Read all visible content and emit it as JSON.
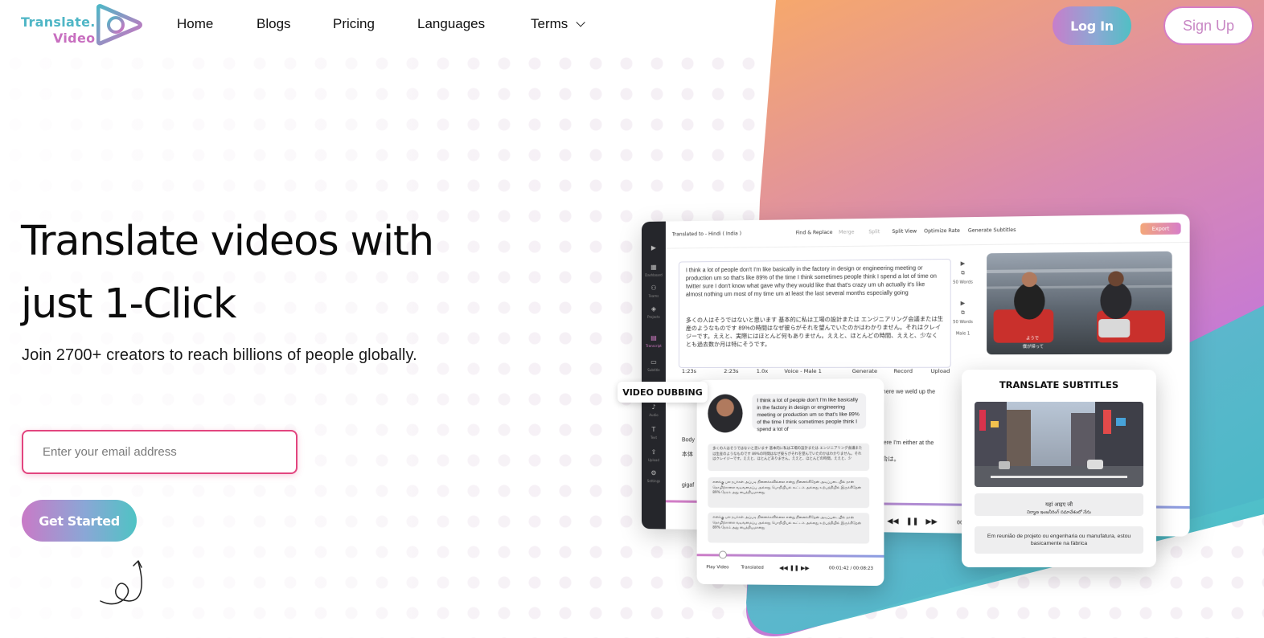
{
  "brand": {
    "line1": "Translate.",
    "line2": "Video"
  },
  "nav": {
    "home": "Home",
    "blogs": "Blogs",
    "pricing": "Pricing",
    "languages": "Languages",
    "terms": "Terms"
  },
  "auth": {
    "login": "Log In",
    "signup": "Sign Up"
  },
  "hero": {
    "title_line1": "Translate videos with",
    "title_line2": "just 1-Click",
    "subtitle": "Join 2700+ creators to reach billions of people globally.",
    "email_placeholder": "Enter your email address",
    "cta": "Get Started"
  },
  "mockup": {
    "translated_to": "Translated to - Hindi ( India )",
    "toolbar": [
      "Find & Replace",
      "Merge",
      "Split",
      "Split View",
      "Optimize Rate",
      "Generate Subtitles"
    ],
    "export": "Export",
    "sidebar": [
      "Dashboard",
      "Teams",
      "Projects",
      "Transcript",
      "Subtitle",
      "Audio",
      "Text",
      "Upload",
      "Settings"
    ],
    "transcript_en": "I think a lot of people don't I'm like basically in the factory in design or engineering meeting or production um so that's like 89% of the time I think sometimes people think I spend a lot of time on twitter sure I don't know what gave why they would like that that's crazy um uh actually it's like almost nothing um most of my time um at least the last several months especially going",
    "transcript_jp": "多くの人はそうではないと思います 基本的に私は工場の設計または エンジニアリング会議または生産のようなものです 89%の時間はなぜ彼らがそれを望んでいたのかはわかりません。それはクレイジーです。ええと、実際にはほとんど何もありません。ええと、ほとんどの時間、ええと、少なくとも過去数か月は特にそうです。",
    "word_count_1": "50 Words",
    "word_count_2": "50 Words",
    "speaker": "Male 1",
    "tools": {
      "start": "1:23s",
      "end": "2:23s",
      "speed": "1.0x",
      "voice": "Voice - Male 1",
      "generate": "Generate",
      "record": "Record",
      "upload": "Upload"
    },
    "lower_line1": "hop where we weld up the",
    "lower_line2": "not here I'm either at the",
    "lower_line3": "い場合は。",
    "lower_body": "Body",
    "lower_cn": "本体",
    "lower_giga": "gigaf",
    "lower_time": "00:0",
    "video_caption_1": "ようで",
    "video_caption_2": "僕が帰って"
  },
  "dubbing": {
    "tag": "VIDEO DUBBING",
    "bubble": "I think a lot of people don't I'm like basically in the factory in design or engineering meeting or production um so that's like 89% of the time I think sometimes people think I spend a lot of",
    "block_jp": "多くの人はそうではないと思います 基本的に私は工場の設計または エンジニアリング会議または生産のようなものです 89%の時間はなぜ彼らがそれを望んでいたのかはわかりません。それはクレイジーです。ええと、ほとんどありません。ええと、ほとんどの時間。ええと、少",
    "block_ta1": "எனக்கு பல நபர்கள் அப்படி நினைக்கவில்லை என்று நினைக்கிறேன் அடிப்படையில் நான் தொழிற்சாலை வடிவமைப்பு அல்லது பொறியியல் கூட்டம் அல்லது உற்பத்தியில் இருக்கிறேன் 89% நேரம் அது பைத்தியமானது",
    "block_ta2": "எனக்கு பல நபர்கள் அப்படி நினைக்கவில்லை என்று நினைக்கிறேன் அடிப்படையில் நான் தொழிற்சாலை வடிவமைப்பு அல்லது பொறியியல் கூட்டம் அல்லது உற்பத்தியில் இருக்கிறேன் 89% நேரம் அது பைத்தியமானது",
    "play_video": "Play Video",
    "translated": "Translated",
    "time": "00:01:42 / 00:08:23"
  },
  "subtitles": {
    "title": "TRANSLATE SUBTITLES",
    "cap_hi": "यहां आइए जी",
    "cap_te": "నిర్మాణ ఇంజనీరింగ్ సమావేశంలో నేను",
    "cap_pt": "Em reunião de projeto ou engenharia ou manufatura, estou basicamente na fábrica"
  },
  "colors": {
    "brand_teal": "#4fb6c6",
    "brand_pink": "#c86fc0",
    "accent_red": "#e2457f",
    "gradient_orange": "#f5a36a",
    "gradient_purple": "#c57bd0",
    "gradient_teal": "#46bcc4"
  }
}
